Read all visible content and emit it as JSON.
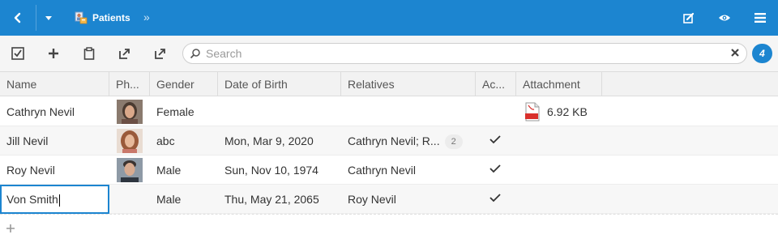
{
  "header": {
    "title": "Patients",
    "breadcrumb_separator": "»",
    "icons": [
      "back-icon",
      "dropdown-icon",
      "patients-icon",
      "edit-icon",
      "eye-icon",
      "menu-icon"
    ]
  },
  "toolbar": {
    "icons": [
      "select-all-icon",
      "add-icon",
      "clipboard-icon",
      "export-icon",
      "export-alt-icon"
    ],
    "search_placeholder": "Search",
    "count": "4"
  },
  "columns": [
    "Name",
    "Ph...",
    "Gender",
    "Date of Birth",
    "Relatives",
    "Ac...",
    "Attachment"
  ],
  "rows": [
    {
      "name": "Cathryn Nevil",
      "gender": "Female",
      "dob": "",
      "relatives": "",
      "relatives_more": "",
      "active": false,
      "attachment": "6.92 KB"
    },
    {
      "name": "Jill Nevil",
      "gender": "abc",
      "dob": "Mon, Mar 9, 2020",
      "relatives": "Cathryn Nevil; R...",
      "relatives_more": "2",
      "active": true,
      "attachment": ""
    },
    {
      "name": "Roy Nevil",
      "gender": "Male",
      "dob": "Sun, Nov 10, 1974",
      "relatives": "Cathryn Nevil",
      "relatives_more": "",
      "active": true,
      "attachment": ""
    },
    {
      "name": "Von Smith",
      "gender": "Male",
      "dob": "Thu, May 21, 2065",
      "relatives": "Roy Nevil",
      "relatives_more": "",
      "active": true,
      "attachment": ""
    }
  ],
  "add_row_label": "+",
  "colors": {
    "accent": "#1c85d0",
    "pdf_red": "#d9302c"
  }
}
